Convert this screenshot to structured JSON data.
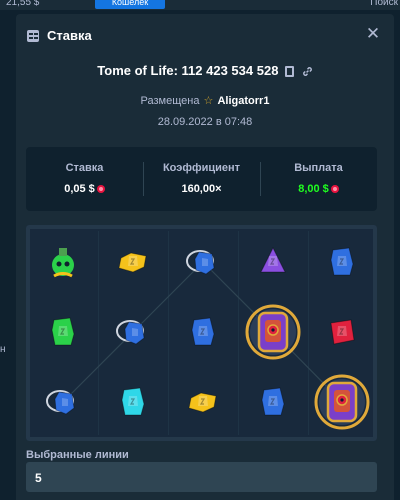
{
  "background": {
    "balance": "21,55 $",
    "deposit_button": "Кошелёк",
    "search": "Поиск",
    "left_edge_text": "н",
    "right_edge_text": ""
  },
  "modal": {
    "title": "Ставка",
    "title_icon": "bet-ticket-icon",
    "close_icon": "close-icon",
    "game_name": "Tome of Life: 112 423 534 528",
    "placed_prefix": "Размещена",
    "username": "Aligatorr1",
    "date": "28.09.2022 в 07:48"
  },
  "stats": {
    "bet_label": "Ставка",
    "bet_value": "0,05 $",
    "multiplier_label": "Коэффициент",
    "multiplier_value": "160,00×",
    "payout_label": "Выплата",
    "payout_value": "8,00 $"
  },
  "board": {
    "symbols": [
      [
        "green-potion",
        "yellow-gem",
        "ring-blue-gem",
        "purple-gem",
        "blue-gem"
      ],
      [
        "green-gem",
        "ring-blue-gem",
        "blue-gem",
        "tome-wild",
        "red-gem"
      ],
      [
        "ring-blue-gem",
        "cyan-gem",
        "yellow-gem",
        "blue-gem",
        "tome-wild"
      ]
    ],
    "colors": {
      "green": "#2bd14a",
      "yellow": "#f5c21b",
      "blue": "#2f6fe0",
      "purple": "#8a4fe0",
      "red": "#e0213e",
      "cyan": "#2fd7e8",
      "gold": "#e0a93a"
    }
  },
  "lines": {
    "label": "Выбранные линии",
    "value": "5"
  },
  "colors": {
    "accent": "#1475e1",
    "payout_green": "#1fff20",
    "panel": "#1a2c38",
    "dark": "#0f212e"
  }
}
